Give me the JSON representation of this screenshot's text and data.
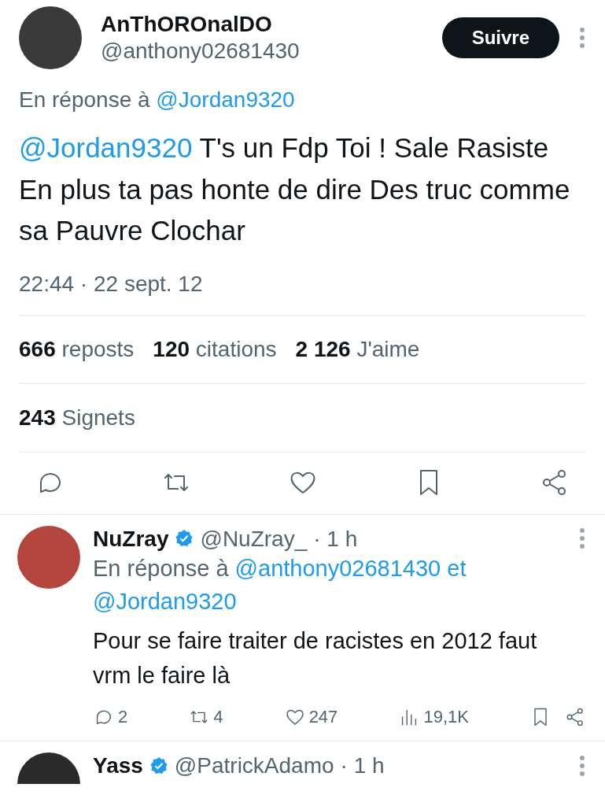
{
  "tweet": {
    "author": {
      "name": "AnThOROnalDO",
      "handle": "@anthony02681430"
    },
    "follow_button": "Suivre",
    "reply_to": {
      "prefix": "En réponse à",
      "mentions": [
        "@Jordan9320"
      ]
    },
    "text": {
      "mention": "@Jordan9320",
      "body": "T's un Fdp Toi ! Sale Rasiste En plus ta pas honte de dire Des truc comme sa Pauvre Clochar"
    },
    "timestamp": "22:44 · 22 sept. 12",
    "stats": [
      {
        "count": "666",
        "label": "reposts"
      },
      {
        "count": "120",
        "label": "citations"
      },
      {
        "count": "2 126",
        "label": "J'aime"
      }
    ],
    "bookmarks": {
      "count": "243",
      "label": "Signets"
    }
  },
  "replies": [
    {
      "name": "NuZray",
      "verified": true,
      "handle": "@NuZray_",
      "time": "· 1 h",
      "reply_to": {
        "prefix": "En réponse à",
        "mentions": [
          "@anthony02681430",
          "@Jordan9320"
        ],
        "joiner": "et"
      },
      "text": "Pour se faire traiter de racistes en 2012 faut vrm le faire là",
      "actions": {
        "replies": "2",
        "reposts": "4",
        "likes": "247",
        "views": "19,1K"
      }
    },
    {
      "name": "Yass",
      "verified": true,
      "handle": "@PatrickAdamo",
      "time": "· 1 h"
    }
  ]
}
